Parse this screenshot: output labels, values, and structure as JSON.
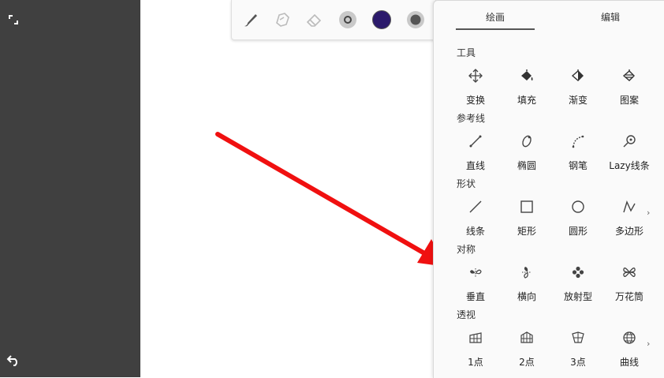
{
  "panel": {
    "tabs": [
      {
        "label": "绘画",
        "active": true
      },
      {
        "label": "编辑",
        "active": false
      }
    ],
    "sections": [
      {
        "title": "工具",
        "tools": [
          {
            "label": "变换",
            "icon": "move-arrows-icon"
          },
          {
            "label": "填充",
            "icon": "fill-bucket-icon"
          },
          {
            "label": "渐变",
            "icon": "gradient-icon"
          },
          {
            "label": "图案",
            "icon": "pattern-icon"
          }
        ]
      },
      {
        "title": "参考线",
        "tools": [
          {
            "label": "直线",
            "icon": "straight-line-icon"
          },
          {
            "label": "椭圆",
            "icon": "ellipse-guide-icon"
          },
          {
            "label": "钢笔",
            "icon": "pen-curve-icon"
          },
          {
            "label": "Lazy线条",
            "icon": "lazy-line-icon"
          }
        ]
      },
      {
        "title": "形状",
        "tools": [
          {
            "label": "线条",
            "icon": "line-shape-icon"
          },
          {
            "label": "矩形",
            "icon": "rectangle-icon"
          },
          {
            "label": "圆形",
            "icon": "circle-icon"
          },
          {
            "label": "多边形",
            "icon": "polygon-icon"
          }
        ]
      },
      {
        "title": "对称",
        "tools": [
          {
            "label": "垂直",
            "icon": "vertical-symmetry-icon"
          },
          {
            "label": "横向",
            "icon": "horizontal-symmetry-icon"
          },
          {
            "label": "放射型",
            "icon": "radial-symmetry-icon"
          },
          {
            "label": "万花筒",
            "icon": "kaleidoscope-icon"
          }
        ]
      },
      {
        "title": "透视",
        "tools": [
          {
            "label": "1点",
            "icon": "one-point-perspective-icon"
          },
          {
            "label": "2点",
            "icon": "two-point-perspective-icon"
          },
          {
            "label": "3点",
            "icon": "three-point-perspective-icon"
          },
          {
            "label": "曲线",
            "icon": "curved-perspective-icon"
          }
        ]
      }
    ],
    "more_glyph": "›"
  },
  "toolbar": {
    "items": [
      "brush-icon",
      "smudge-icon",
      "eraser-icon",
      "brush-size-icon",
      "color-swatch-icon",
      "opacity-icon"
    ],
    "color": "#2b1a6b"
  },
  "sidebar": {
    "items": [
      "expand-icon",
      "undo-icon"
    ]
  },
  "colors": {
    "sidebar_bg": "#404040",
    "annotation_arrow": "#f01010"
  }
}
